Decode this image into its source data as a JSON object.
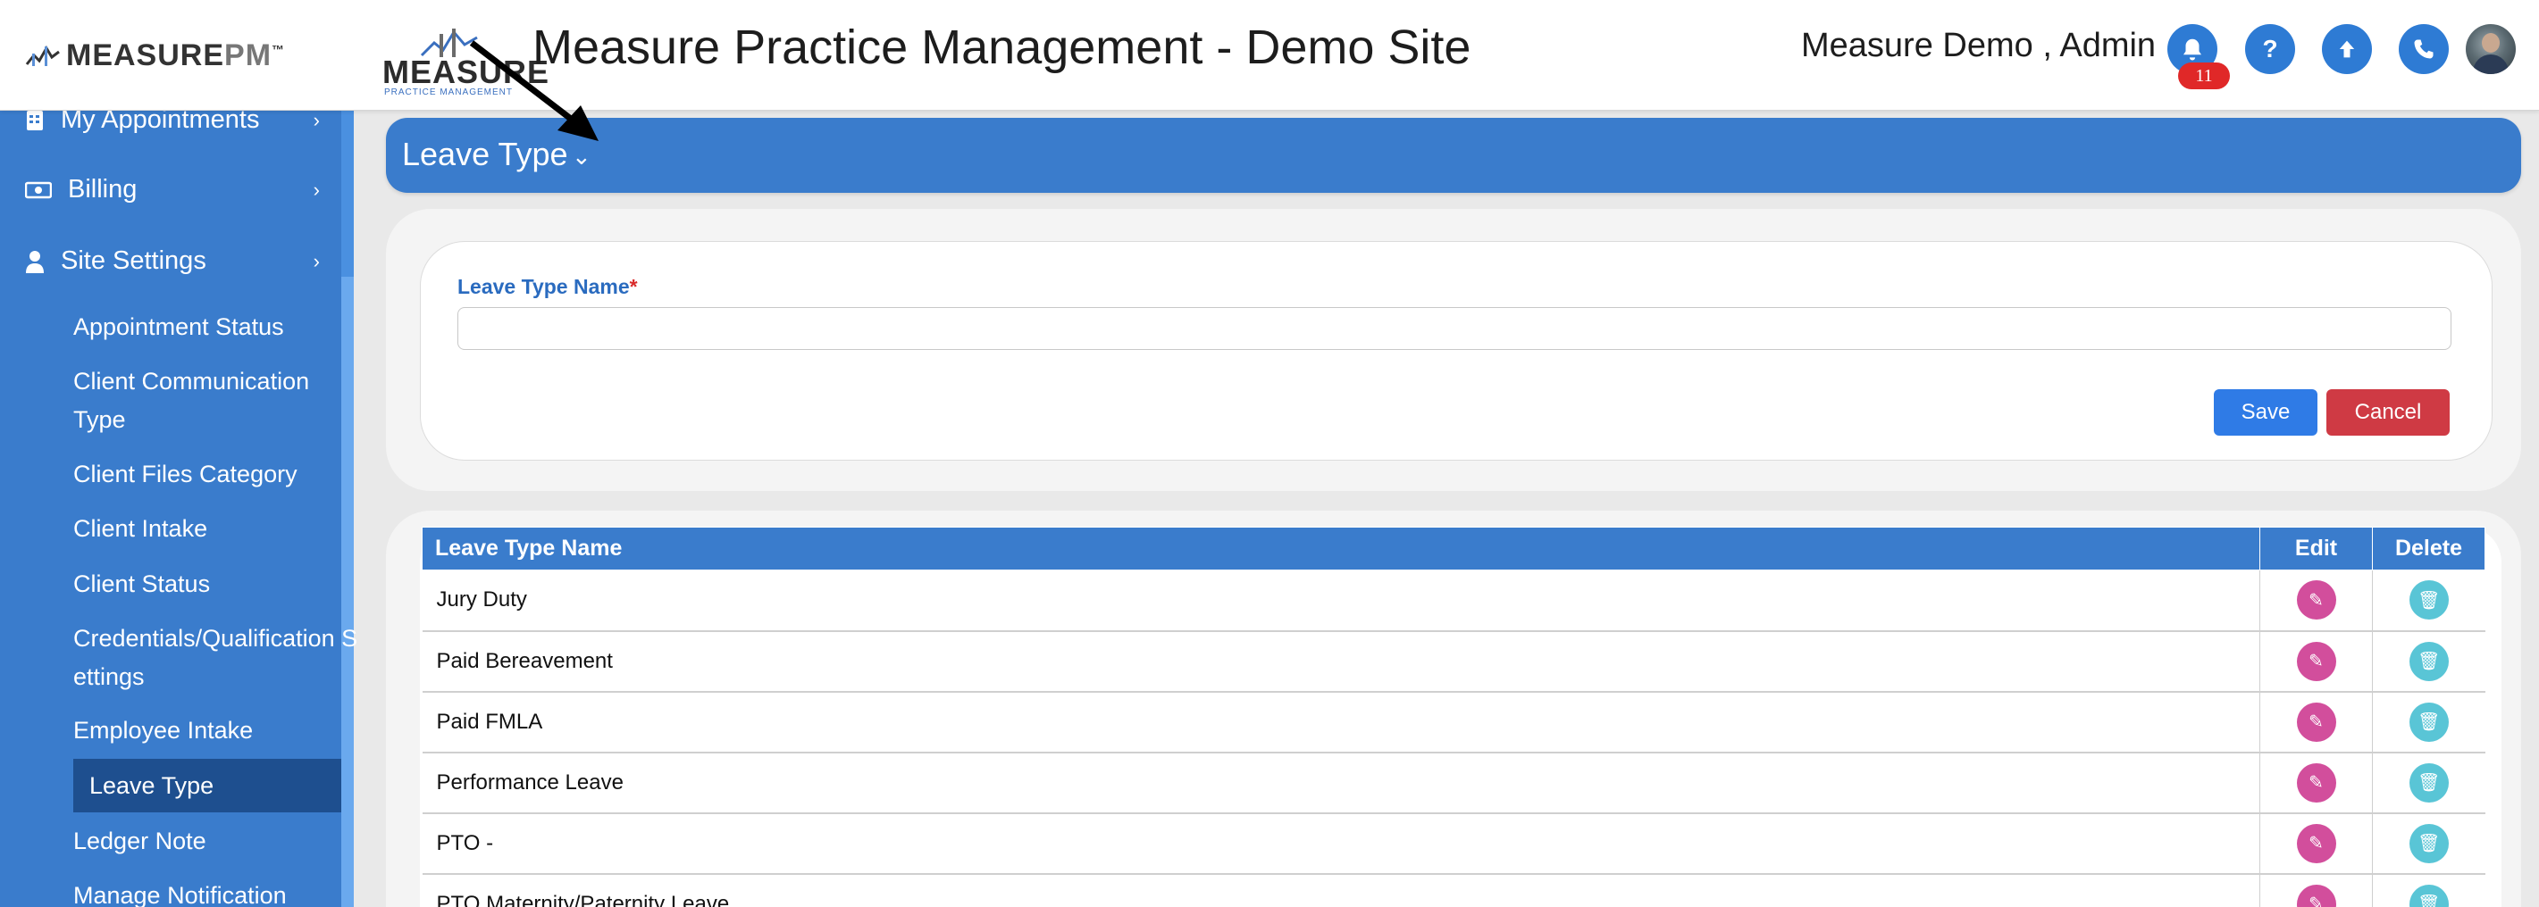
{
  "header": {
    "brand": {
      "main": "MEASURE",
      "suffix": "PM",
      "tm": "™"
    },
    "logo": {
      "word": "MEASURE",
      "sub": "PRACTICE MANAGEMENT"
    },
    "title": "Measure Practice Management - Demo Site",
    "user": "Measure Demo , Admin",
    "icons": [
      {
        "name": "bell-icon",
        "glyph": "🔔"
      },
      {
        "name": "help-icon",
        "glyph": "?"
      },
      {
        "name": "upload-icon",
        "glyph": "⬆"
      },
      {
        "name": "phone-icon",
        "glyph": "✆"
      }
    ],
    "notification_count": "11",
    "accent": "#2e7bd4"
  },
  "sidebar": {
    "main_items": [
      {
        "label": "My Appointments",
        "icon": "calendar-icon"
      },
      {
        "label": "Billing",
        "icon": "money-icon"
      },
      {
        "label": "Site Settings",
        "icon": "user-icon"
      }
    ],
    "sub_items": [
      {
        "label": "Appointment Status"
      },
      {
        "label": "Client Communication Type"
      },
      {
        "label": "Client Files Category"
      },
      {
        "label": "Client Intake"
      },
      {
        "label": "Client Status"
      },
      {
        "label": "Credentials/Qualification Settings"
      },
      {
        "label": "Employee Intake"
      },
      {
        "label": "Leave Type",
        "active": true
      },
      {
        "label": "Ledger Note"
      },
      {
        "label": "Manage Notification"
      }
    ],
    "color": "#3a7ccc"
  },
  "panel": {
    "title": "Leave Type",
    "chevron": "⌄"
  },
  "form": {
    "label": "Leave Type Name",
    "required_mark": "*",
    "value": "",
    "save_label": "Save",
    "cancel_label": "Cancel"
  },
  "table": {
    "columns": [
      "Leave Type Name",
      "Edit",
      "Delete"
    ],
    "rows": [
      {
        "name": "Jury Duty"
      },
      {
        "name": "Paid Bereavement"
      },
      {
        "name": "Paid FMLA"
      },
      {
        "name": "Performance Leave"
      },
      {
        "name": "PTO -"
      },
      {
        "name": "PTO Maternity/Paternity Leave"
      }
    ]
  }
}
